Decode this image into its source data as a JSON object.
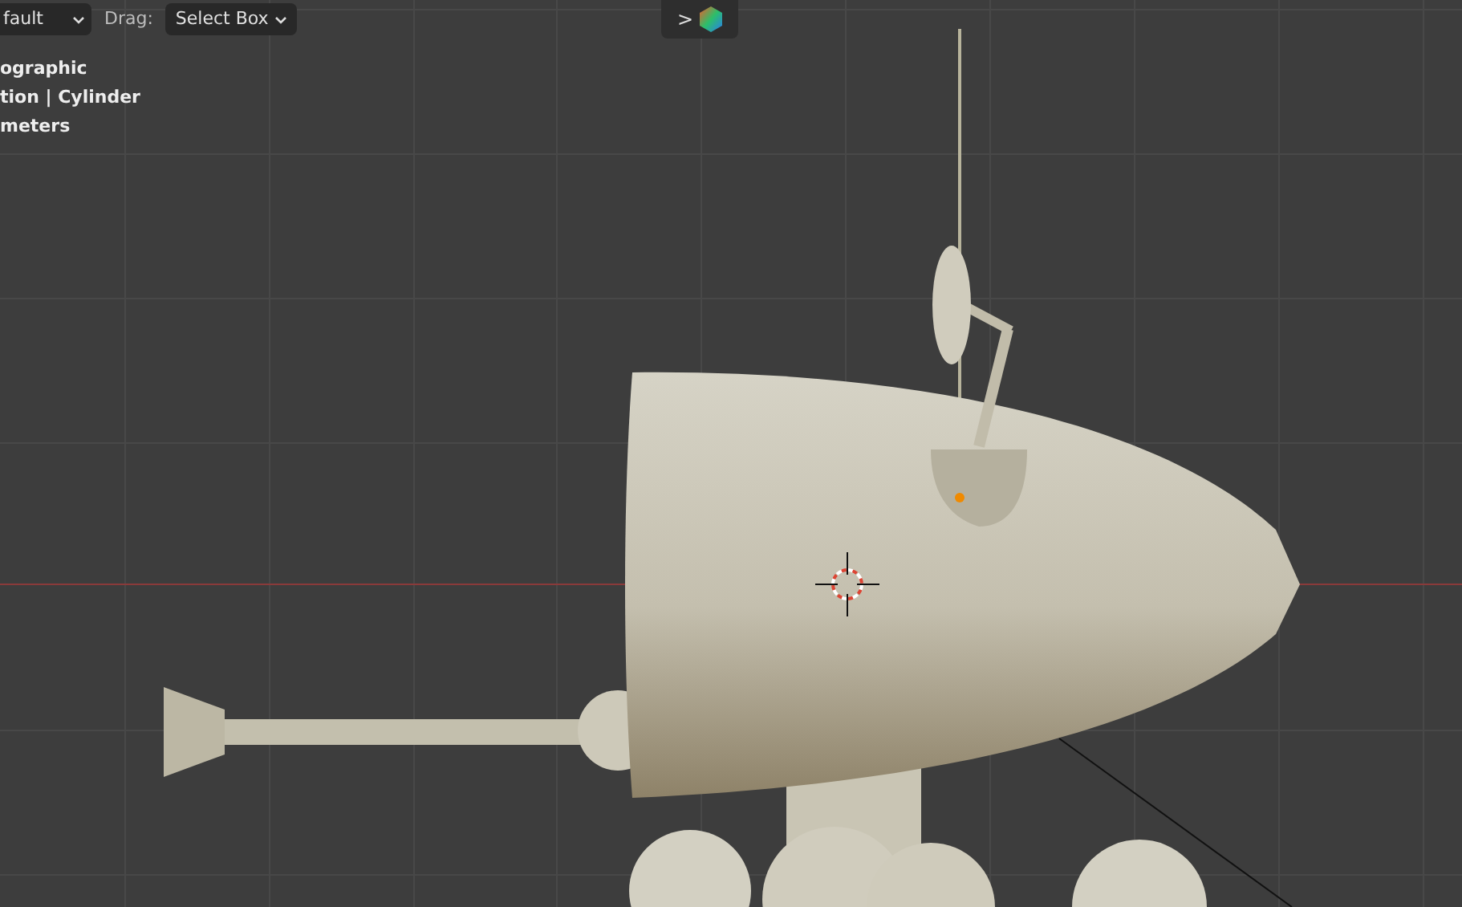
{
  "header": {
    "orientation_dropdown": "fault",
    "drag_label": "Drag:",
    "drag_dropdown": "Select Box",
    "gizmo_toggle": ">"
  },
  "viewport_info": [
    "ographic",
    "tion | Cylinder",
    "meters"
  ]
}
